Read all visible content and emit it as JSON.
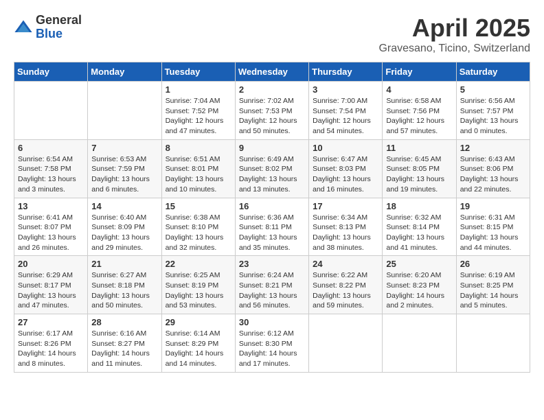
{
  "logo": {
    "general": "General",
    "blue": "Blue"
  },
  "title": "April 2025",
  "location": "Gravesano, Ticino, Switzerland",
  "days_of_week": [
    "Sunday",
    "Monday",
    "Tuesday",
    "Wednesday",
    "Thursday",
    "Friday",
    "Saturday"
  ],
  "weeks": [
    [
      {
        "day": "",
        "info": ""
      },
      {
        "day": "",
        "info": ""
      },
      {
        "day": "1",
        "info": "Sunrise: 7:04 AM\nSunset: 7:52 PM\nDaylight: 12 hours and 47 minutes."
      },
      {
        "day": "2",
        "info": "Sunrise: 7:02 AM\nSunset: 7:53 PM\nDaylight: 12 hours and 50 minutes."
      },
      {
        "day": "3",
        "info": "Sunrise: 7:00 AM\nSunset: 7:54 PM\nDaylight: 12 hours and 54 minutes."
      },
      {
        "day": "4",
        "info": "Sunrise: 6:58 AM\nSunset: 7:56 PM\nDaylight: 12 hours and 57 minutes."
      },
      {
        "day": "5",
        "info": "Sunrise: 6:56 AM\nSunset: 7:57 PM\nDaylight: 13 hours and 0 minutes."
      }
    ],
    [
      {
        "day": "6",
        "info": "Sunrise: 6:54 AM\nSunset: 7:58 PM\nDaylight: 13 hours and 3 minutes."
      },
      {
        "day": "7",
        "info": "Sunrise: 6:53 AM\nSunset: 7:59 PM\nDaylight: 13 hours and 6 minutes."
      },
      {
        "day": "8",
        "info": "Sunrise: 6:51 AM\nSunset: 8:01 PM\nDaylight: 13 hours and 10 minutes."
      },
      {
        "day": "9",
        "info": "Sunrise: 6:49 AM\nSunset: 8:02 PM\nDaylight: 13 hours and 13 minutes."
      },
      {
        "day": "10",
        "info": "Sunrise: 6:47 AM\nSunset: 8:03 PM\nDaylight: 13 hours and 16 minutes."
      },
      {
        "day": "11",
        "info": "Sunrise: 6:45 AM\nSunset: 8:05 PM\nDaylight: 13 hours and 19 minutes."
      },
      {
        "day": "12",
        "info": "Sunrise: 6:43 AM\nSunset: 8:06 PM\nDaylight: 13 hours and 22 minutes."
      }
    ],
    [
      {
        "day": "13",
        "info": "Sunrise: 6:41 AM\nSunset: 8:07 PM\nDaylight: 13 hours and 26 minutes."
      },
      {
        "day": "14",
        "info": "Sunrise: 6:40 AM\nSunset: 8:09 PM\nDaylight: 13 hours and 29 minutes."
      },
      {
        "day": "15",
        "info": "Sunrise: 6:38 AM\nSunset: 8:10 PM\nDaylight: 13 hours and 32 minutes."
      },
      {
        "day": "16",
        "info": "Sunrise: 6:36 AM\nSunset: 8:11 PM\nDaylight: 13 hours and 35 minutes."
      },
      {
        "day": "17",
        "info": "Sunrise: 6:34 AM\nSunset: 8:13 PM\nDaylight: 13 hours and 38 minutes."
      },
      {
        "day": "18",
        "info": "Sunrise: 6:32 AM\nSunset: 8:14 PM\nDaylight: 13 hours and 41 minutes."
      },
      {
        "day": "19",
        "info": "Sunrise: 6:31 AM\nSunset: 8:15 PM\nDaylight: 13 hours and 44 minutes."
      }
    ],
    [
      {
        "day": "20",
        "info": "Sunrise: 6:29 AM\nSunset: 8:17 PM\nDaylight: 13 hours and 47 minutes."
      },
      {
        "day": "21",
        "info": "Sunrise: 6:27 AM\nSunset: 8:18 PM\nDaylight: 13 hours and 50 minutes."
      },
      {
        "day": "22",
        "info": "Sunrise: 6:25 AM\nSunset: 8:19 PM\nDaylight: 13 hours and 53 minutes."
      },
      {
        "day": "23",
        "info": "Sunrise: 6:24 AM\nSunset: 8:21 PM\nDaylight: 13 hours and 56 minutes."
      },
      {
        "day": "24",
        "info": "Sunrise: 6:22 AM\nSunset: 8:22 PM\nDaylight: 13 hours and 59 minutes."
      },
      {
        "day": "25",
        "info": "Sunrise: 6:20 AM\nSunset: 8:23 PM\nDaylight: 14 hours and 2 minutes."
      },
      {
        "day": "26",
        "info": "Sunrise: 6:19 AM\nSunset: 8:25 PM\nDaylight: 14 hours and 5 minutes."
      }
    ],
    [
      {
        "day": "27",
        "info": "Sunrise: 6:17 AM\nSunset: 8:26 PM\nDaylight: 14 hours and 8 minutes."
      },
      {
        "day": "28",
        "info": "Sunrise: 6:16 AM\nSunset: 8:27 PM\nDaylight: 14 hours and 11 minutes."
      },
      {
        "day": "29",
        "info": "Sunrise: 6:14 AM\nSunset: 8:29 PM\nDaylight: 14 hours and 14 minutes."
      },
      {
        "day": "30",
        "info": "Sunrise: 6:12 AM\nSunset: 8:30 PM\nDaylight: 14 hours and 17 minutes."
      },
      {
        "day": "",
        "info": ""
      },
      {
        "day": "",
        "info": ""
      },
      {
        "day": "",
        "info": ""
      }
    ]
  ]
}
